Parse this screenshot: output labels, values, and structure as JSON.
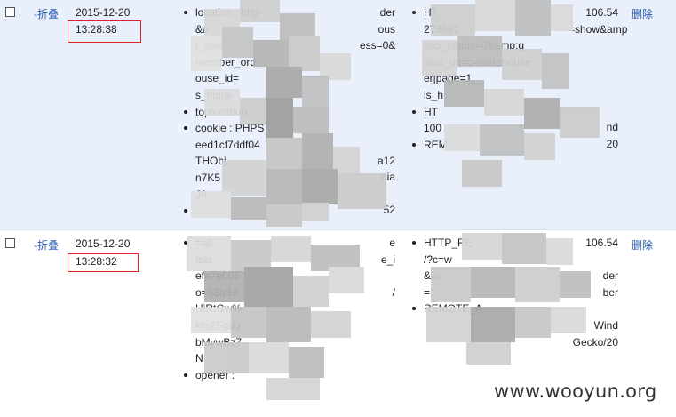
{
  "rows": [
    {
      "fold": "-折叠",
      "date": "2015-12-20",
      "time": "13:28:38",
      "delete": "删除",
      "col1": [
        "location : http",
        "&a",
        "r_stat",
        "member_ord",
        "ouse_id=",
        "s_hidde",
        "toplocation",
        "cookie : PHPS",
        "eed1cf7ddf04",
        "THObj",
        "n7K5",
        "J8",
        "",
        ""
      ],
      "col1_right": [
        "der",
        "ous",
        "ess=0&",
        "a12",
        "cia",
        "52"
      ],
      "col2": [
        "HT",
        "273681",
        "sub_status=0&amp;g",
        ";last_url=c=warehouse",
        "er|page=1",
        "is_h",
        "HT",
        "",
        "100",
        "REM"
      ],
      "col2_right": [
        "106.54",
        "=show&amp",
        "nd",
        "20"
      ]
    },
    {
      "fold": "-折叠",
      "date": "2015-12-20",
      "time": "13:28:32",
      "delete": "删除",
      "col1": [
        "",
        "",
        "=all",
        "iplo",
        "",
        "efe7e005",
        "o=63afHr",
        "HiRtGw%",
        "k%2Fgug",
        "bMywBz7",
        "N",
        "opener :"
      ],
      "col1_right": [
        "e",
        "e_i",
        "/"
      ],
      "col2": [
        "HTTP_RE",
        "/?c=w",
        "&ar",
        "=1",
        "",
        "",
        "REMOTE_A"
      ],
      "col2_right": [
        "106.54",
        "der",
        "ber",
        "Wind",
        "Gecko/20"
      ]
    }
  ],
  "watermark": "www.wooyun.org"
}
